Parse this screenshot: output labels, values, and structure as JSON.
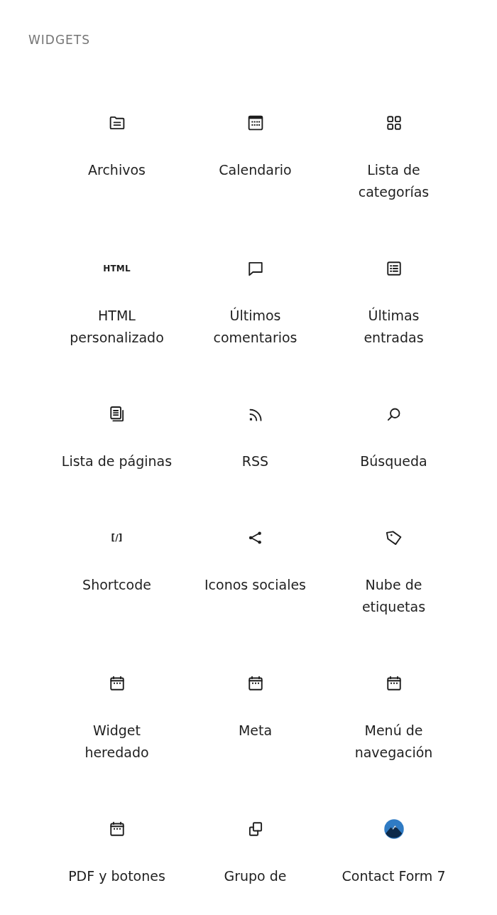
{
  "heading": "WIDGETS",
  "widgets": [
    {
      "kind": "folder",
      "label": "Archivos"
    },
    {
      "kind": "calendar-solid",
      "label": "Calendario"
    },
    {
      "kind": "grid",
      "label": "Lista de\ncategorías"
    },
    {
      "kind": "text",
      "icon_text": "HTML",
      "label": "HTML\npersonalizado"
    },
    {
      "kind": "comment",
      "label": "Últimos\ncomentarios"
    },
    {
      "kind": "list",
      "label": "Últimas\nentradas"
    },
    {
      "kind": "pages",
      "label": "Lista de páginas"
    },
    {
      "kind": "rss",
      "label": "RSS"
    },
    {
      "kind": "search",
      "label": "Búsqueda"
    },
    {
      "kind": "text",
      "icon_text": "[/]",
      "label": "Shortcode"
    },
    {
      "kind": "share",
      "label": "Iconos sociales"
    },
    {
      "kind": "tag",
      "label": "Nube de\netiquetas"
    },
    {
      "kind": "calendar",
      "label": "Widget\nheredado"
    },
    {
      "kind": "calendar",
      "label": "Meta"
    },
    {
      "kind": "calendar",
      "label": "Menú de\nnavegación"
    },
    {
      "kind": "calendar",
      "label": "PDF y botones"
    },
    {
      "kind": "group",
      "label": "Grupo de"
    },
    {
      "kind": "logo",
      "label": "Contact Form 7"
    }
  ]
}
